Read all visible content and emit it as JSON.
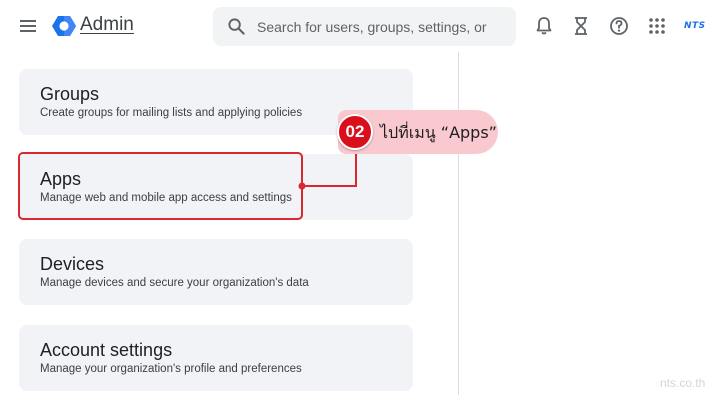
{
  "header": {
    "app_title": "Admin",
    "search_placeholder": "Search for users, groups, settings, or",
    "brand_mark": "NTS",
    "icons": [
      "menu-icon",
      "admin-logo-icon",
      "search-icon",
      "notifications-bell-icon",
      "hourglass-tasks-icon",
      "help-icon",
      "apps-grid-icon"
    ]
  },
  "cards": [
    {
      "title": "Groups",
      "description": "Create groups for mailing lists and applying policies"
    },
    {
      "title": "Apps",
      "description": "Manage web and mobile app access and settings"
    },
    {
      "title": "Devices",
      "description": "Manage devices and secure your organization's data"
    },
    {
      "title": "Account settings",
      "description": "Manage your organization's profile and preferences"
    }
  ],
  "annotation": {
    "step_number": "02",
    "instruction": "ไปที่เมนู “Apps”",
    "accent_color": "#d9101c",
    "callout_background": "#f9c9cf"
  },
  "watermark": "nts.co.th"
}
